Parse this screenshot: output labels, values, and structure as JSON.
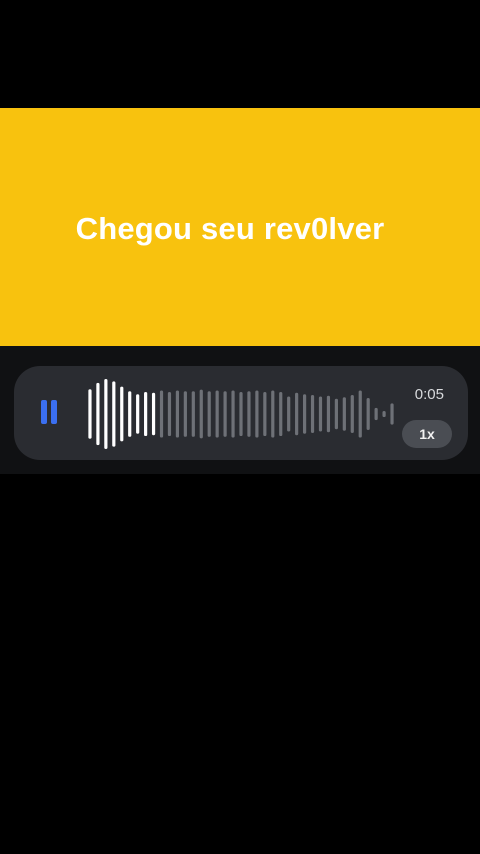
{
  "banner": {
    "title": "Chegou seu rev0lver",
    "background_color": "#F8C20E"
  },
  "audio_player": {
    "state": "playing",
    "pause_icon": "pause-icon",
    "accent_color": "#3B6FF0",
    "elapsed_time": "0:05",
    "playback_speed": "1x",
    "waveform": {
      "played_fraction": 0.22,
      "bar_levels": [
        0.65,
        0.82,
        0.92,
        0.86,
        0.72,
        0.6,
        0.52,
        0.58,
        0.56,
        0.62,
        0.58,
        0.62,
        0.6,
        0.6,
        0.64,
        0.6,
        0.62,
        0.6,
        0.62,
        0.58,
        0.6,
        0.62,
        0.58,
        0.62,
        0.58,
        0.46,
        0.56,
        0.52,
        0.5,
        0.46,
        0.48,
        0.4,
        0.44,
        0.5,
        0.62,
        0.42,
        0.16,
        0.08,
        0.28
      ]
    }
  }
}
